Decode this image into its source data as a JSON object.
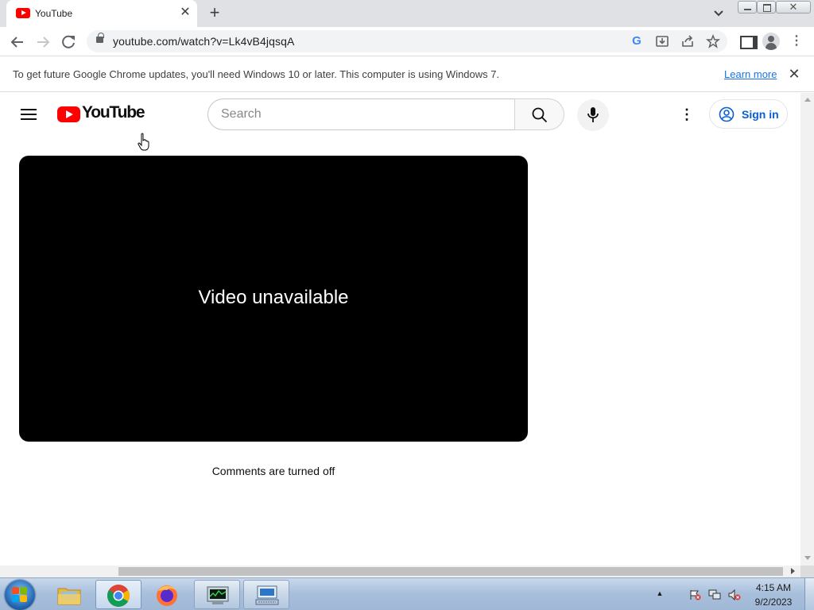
{
  "browser": {
    "tab": {
      "title": "YouTube",
      "close_glyph": "✕",
      "favicon": "youtube-icon"
    },
    "new_tab_glyph": "+",
    "address_bar": {
      "url": "youtube.com/watch?v=Lk4vB4jqsqA"
    },
    "infobar": {
      "message": "To get future Google Chrome updates, you'll need Windows 10 or later. This computer is using Windows 7.",
      "link": "Learn more",
      "close_glyph": "✕"
    }
  },
  "youtube": {
    "logo_text": "YouTube",
    "search": {
      "placeholder": "Search"
    },
    "more_glyph": "⋮",
    "sign_in_label": "Sign in",
    "player": {
      "message": "Video unavailable"
    },
    "comments_status": "Comments are turned off"
  },
  "taskbar": {
    "clock": {
      "time": "4:15 AM",
      "date": "9/2/2023"
    },
    "tray_arrow": "▲",
    "apps": [
      {
        "name": "windows-explorer",
        "active": false
      },
      {
        "name": "google-chrome",
        "active": true
      },
      {
        "name": "firefox",
        "active": false
      },
      {
        "name": "task-manager",
        "active": false
      },
      {
        "name": "network-app",
        "active": false
      }
    ]
  },
  "colors": {
    "youtube_red": "#ff0000",
    "link_blue": "#1a73e8",
    "sign_in_blue": "#065fd4",
    "player_bg": "#000000"
  }
}
